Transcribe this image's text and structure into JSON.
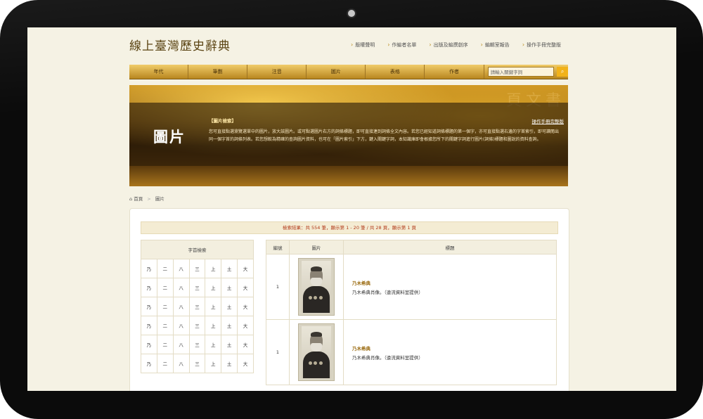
{
  "site": {
    "title": "線上臺灣歷史辭典"
  },
  "top_nav": [
    "版權聲明",
    "作編者名單",
    "出版及編撰創序",
    "編輯室報告",
    "操作手冊完整版"
  ],
  "menu": [
    "年代",
    "筆劃",
    "注音",
    "圖片",
    "表格",
    "作者"
  ],
  "search": {
    "placeholder": "請輸入關鍵字詞",
    "button_icon": "search-icon"
  },
  "banner": {
    "title": "圖片",
    "section_label": "【圖片檢索】",
    "manual_link": "操作手冊完整版",
    "description": "您可直接點選瀏覽選單中的圖片，放大該圖片。或可點選圖片右方的詞條標題，即可直接連到詞條全文內容。若您已經知道詞條標題的第一個字，亦可直接點選右邊的字首索引，即可讀閱出同一個字首的詞條列表。若您想較為精確的查詢圖片資料，也可在「圖片索引」下方，鍵入關鍵字詞，本知識庫即會根據您所下的關鍵字詞進行圖片(詞條)標題和圖說的資料查詢。",
    "glyphs": "頁文書"
  },
  "breadcrumb": {
    "home": "首頁",
    "separator": ">",
    "current": "圖片"
  },
  "results": {
    "summary": "檢索結果：共 554 筆，顯示第 1 - 20 筆 / 共 28 頁，顯示第 1 頁",
    "headers": {
      "number": "編號",
      "image": "圖片",
      "title": "標題"
    },
    "rows": [
      {
        "number": "1",
        "title": "乃木希典",
        "caption": "乃木希典肖像。（遠流資料室提供）"
      },
      {
        "number": "1",
        "title": "乃木希典",
        "caption": "乃木希典肖像。（遠流資料室提供）"
      }
    ]
  },
  "index": {
    "header": "字首檢索",
    "rows": [
      [
        "乃",
        "二",
        "八",
        "三",
        "上",
        "土",
        "大"
      ],
      [
        "乃",
        "二",
        "八",
        "三",
        "上",
        "土",
        "大"
      ],
      [
        "乃",
        "二",
        "八",
        "三",
        "上",
        "土",
        "大"
      ],
      [
        "乃",
        "二",
        "八",
        "三",
        "上",
        "土",
        "大"
      ],
      [
        "乃",
        "二",
        "八",
        "三",
        "上",
        "土",
        "大"
      ],
      [
        "乃",
        "二",
        "八",
        "三",
        "上",
        "土",
        "大"
      ]
    ]
  }
}
